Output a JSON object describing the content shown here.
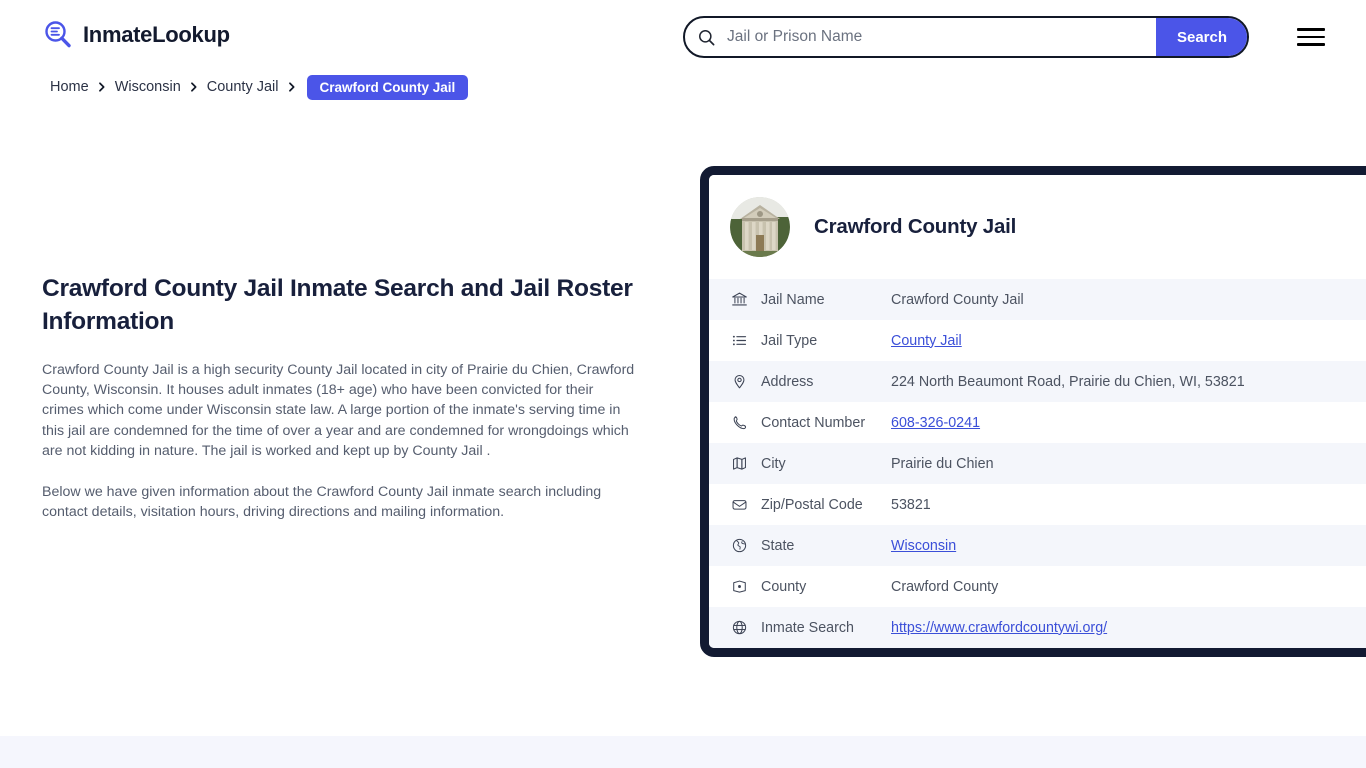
{
  "header": {
    "brand": "InmateLookup",
    "brand_icon": "magnifier-list-icon",
    "search": {
      "placeholder": "Jail or Prison Name",
      "value": "",
      "button_label": "Search",
      "icon": "search-icon"
    },
    "menu_icon": "hamburger-menu-icon"
  },
  "breadcrumb": {
    "items": [
      {
        "label": "Home"
      },
      {
        "label": "Wisconsin"
      },
      {
        "label": "County Jail"
      }
    ],
    "current": "Crawford County Jail",
    "separator": "❯"
  },
  "main": {
    "title": "Crawford County Jail Inmate Search and Jail Roster Information",
    "paragraph1": "Crawford County Jail is a high security County Jail located in city of Prairie du Chien, Crawford County, Wisconsin. It houses adult inmates (18+ age) who have been convicted for their crimes which come under Wisconsin state law. A large portion of the inmate's serving time in this jail are condemned for the time of over a year and are condemned for wrongdoings which are not kidding in nature. The jail is worked and kept up by County Jail .",
    "paragraph2": "Below we have given information about the Crawford County Jail inmate search including contact details, visitation hours, driving directions and mailing information."
  },
  "card": {
    "title": "Crawford County Jail",
    "avatar_icon": "courthouse-building-photo",
    "rows": [
      {
        "icon": "bank-building-icon",
        "label": "Jail Name",
        "value": "Crawford County Jail",
        "link": false
      },
      {
        "icon": "list-icon",
        "label": "Jail Type",
        "value": "County Jail",
        "link": true
      },
      {
        "icon": "map-pin-icon",
        "label": "Address",
        "value": "224 North Beaumont Road, Prairie du Chien, WI, 53821",
        "link": false
      },
      {
        "icon": "phone-icon",
        "label": "Contact Number",
        "value": "608-326-0241",
        "link": true
      },
      {
        "icon": "map-icon",
        "label": "City",
        "value": "Prairie du Chien",
        "link": false
      },
      {
        "icon": "envelope-icon",
        "label": "Zip/Postal Code",
        "value": "53821",
        "link": false
      },
      {
        "icon": "globe-americas-icon",
        "label": "State",
        "value": "Wisconsin",
        "link": true
      },
      {
        "icon": "county-marker-icon",
        "label": "County",
        "value": "Crawford County",
        "link": false
      },
      {
        "icon": "globe-icon",
        "label": "Inmate Search",
        "value": "https://www.crawfordcountywi.org/",
        "link": true
      }
    ]
  },
  "colors": {
    "accent": "#4b55e8",
    "card_border": "#121a32",
    "row_alt": "#f4f6fb",
    "link": "#3b4fd8",
    "band": "#f5f6fd"
  }
}
